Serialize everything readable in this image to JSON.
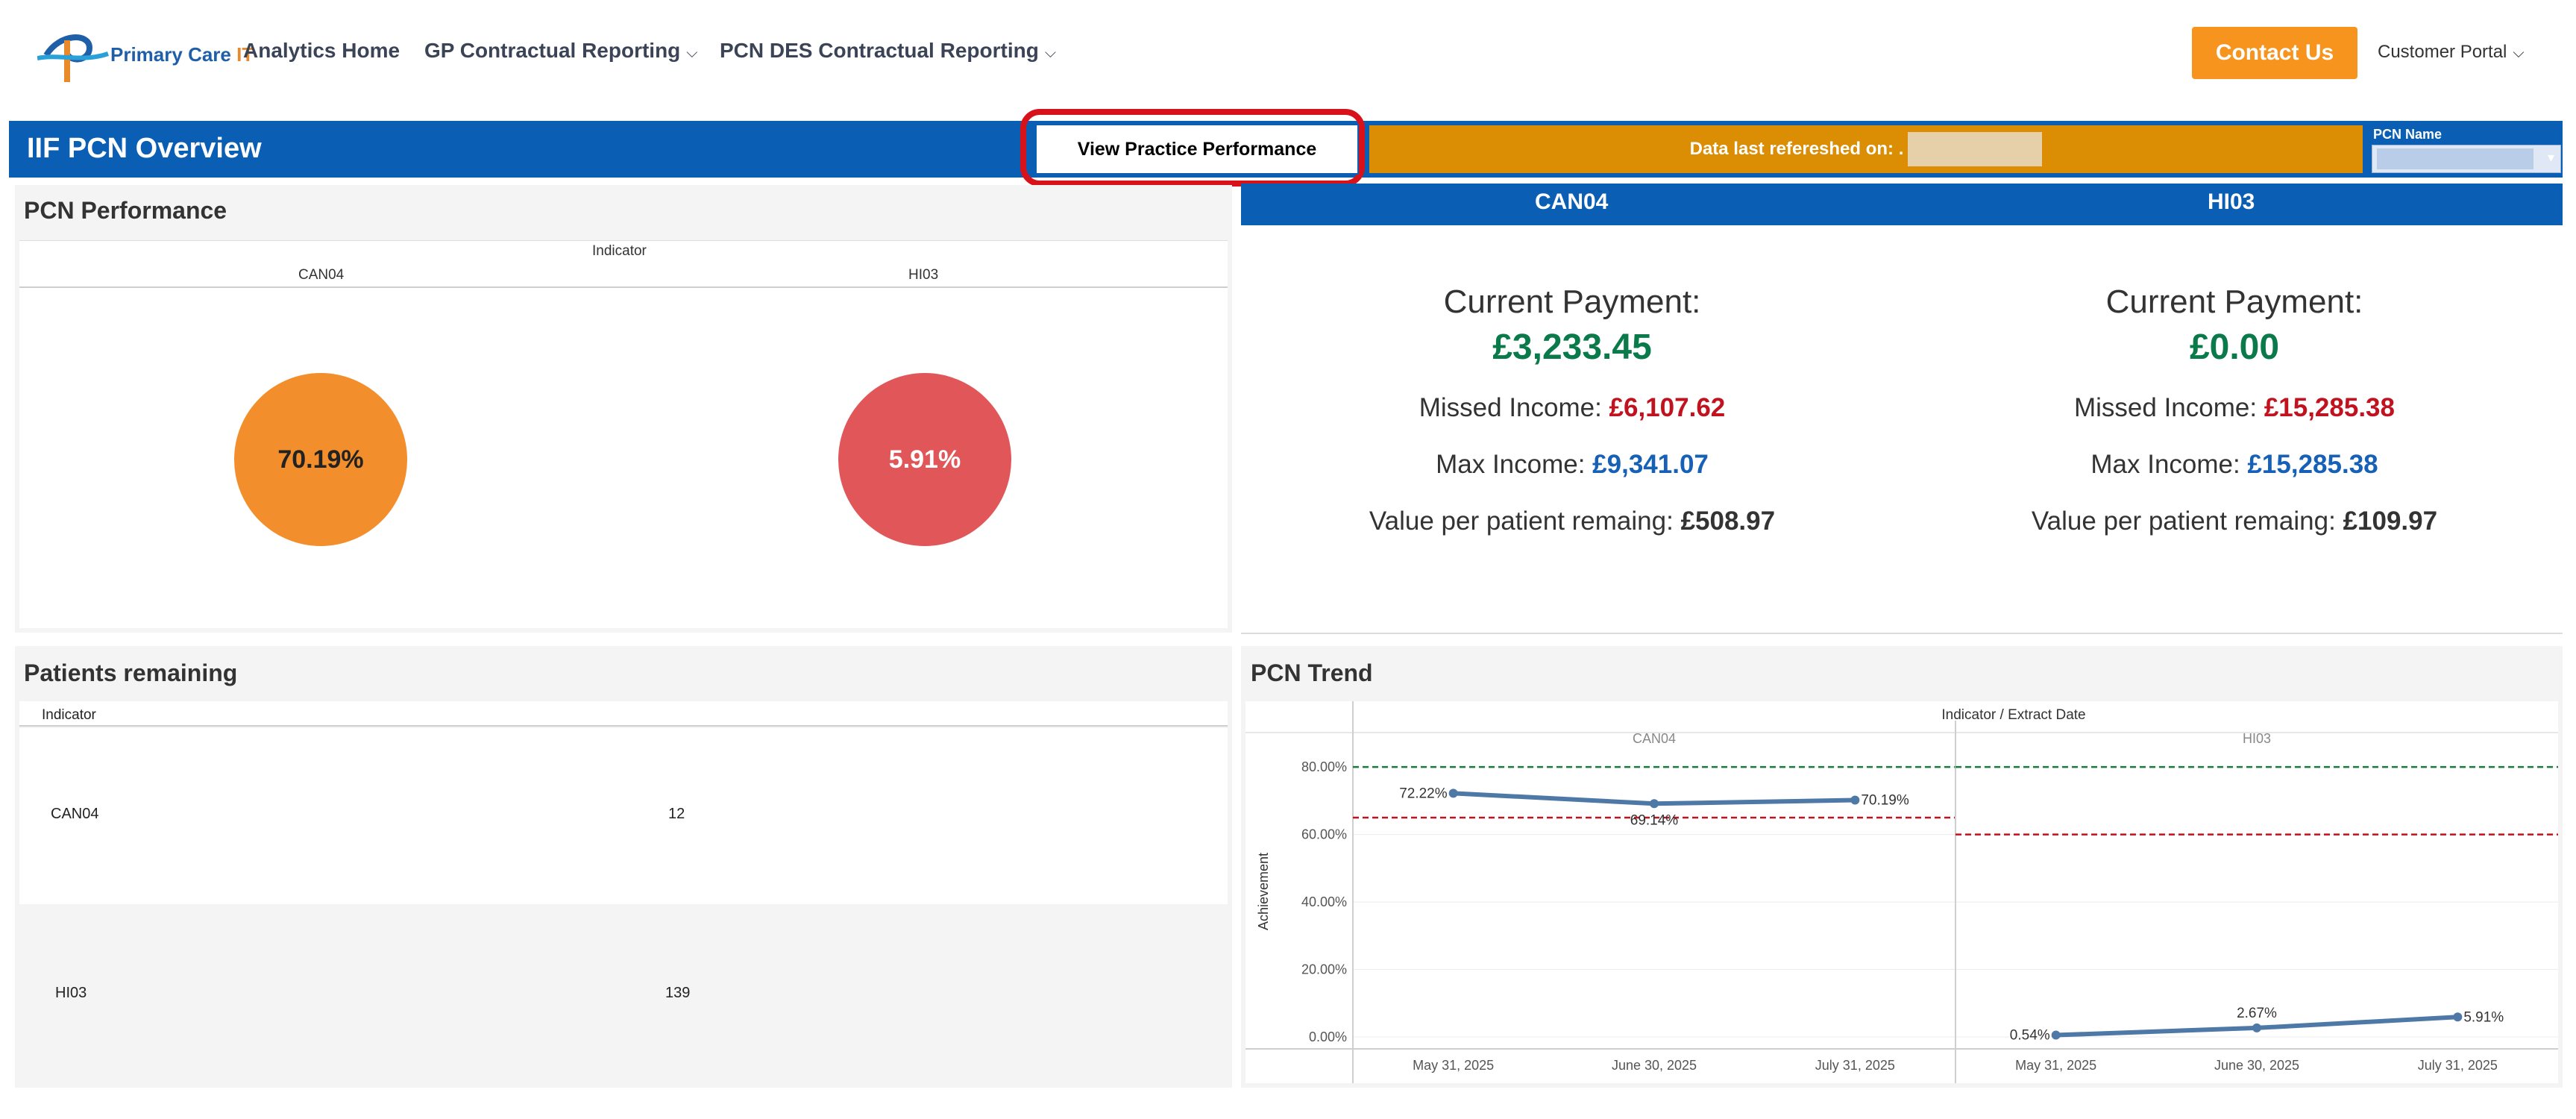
{
  "nav": {
    "logo_text_1": "Primary Care",
    "logo_text_2": "IT",
    "links": [
      {
        "label": "Analytics Home"
      },
      {
        "label": "GP Contractual Reporting",
        "dropdown": true
      },
      {
        "label": "PCN DES Contractual Reporting",
        "dropdown": true
      }
    ],
    "contact_label": "Contact Us",
    "customer_portal": "Customer Portal"
  },
  "header": {
    "title": "IIF PCN Overview",
    "view_practice_label": "View Practice Performance",
    "refresh_label": "Data last refereshed on: .",
    "pcn_name_label": "PCN Name"
  },
  "performance": {
    "title": "PCN Performance",
    "indicator_label": "Indicator",
    "indicators": [
      {
        "name": "CAN04",
        "value": "70.19%",
        "color": "#f28e2b"
      },
      {
        "name": "HI03",
        "value": "5.91%",
        "color": "#e15759"
      }
    ]
  },
  "payments": [
    {
      "indicator": "CAN04",
      "current_label": "Current Payment:",
      "current_value": "£3,233.45",
      "missed_label": "Missed Income: ",
      "missed_value": "£6,107.62",
      "max_label": "Max Income: ",
      "max_value": "£9,341.07",
      "vpp_label": "Value per patient remaing: ",
      "vpp_value": "£508.97"
    },
    {
      "indicator": "HI03",
      "current_label": "Current Payment:",
      "current_value": "£0.00",
      "missed_label": "Missed Income: ",
      "missed_value": "£15,285.38",
      "max_label": "Max Income: ",
      "max_value": "£15,285.38",
      "vpp_label": "Value per patient remaing: ",
      "vpp_value": "£109.97"
    }
  ],
  "patients_remaining": {
    "title": "Patients remaining",
    "column_label": "Indicator",
    "rows": [
      {
        "indicator": "CAN04",
        "value": "12"
      },
      {
        "indicator": "HI03",
        "value": "139"
      }
    ]
  },
  "trend": {
    "title": "PCN Trend",
    "header_label": "Indicator / Extract Date",
    "ylabel": "Achievement",
    "yticks": [
      "0.00%",
      "20.00%",
      "40.00%",
      "60.00%",
      "80.00%"
    ],
    "colors": {
      "line": "#4e79a7",
      "target_green": "#1b7a3e",
      "target_red": "#c1121f"
    }
  },
  "chart_data": {
    "type": "line",
    "title": "",
    "ylabel": "Achievement",
    "ylim": [
      0,
      0.88
    ],
    "panels": [
      {
        "name": "CAN04",
        "x": [
          "May 31, 2025",
          "June 30, 2025",
          "July 31, 2025"
        ],
        "values": [
          0.7222,
          0.6914,
          0.7019
        ],
        "labels": [
          "72.22%",
          "69.14%",
          "70.19%"
        ],
        "upper_threshold": 0.8,
        "lower_threshold": 0.65
      },
      {
        "name": "HI03",
        "x": [
          "May 31, 2025",
          "June 30, 2025",
          "July 31, 2025"
        ],
        "values": [
          0.0054,
          0.0267,
          0.0591
        ],
        "labels": [
          "0.54%",
          "2.67%",
          "5.91%"
        ],
        "upper_threshold": 0.8,
        "lower_threshold": 0.6
      }
    ]
  }
}
